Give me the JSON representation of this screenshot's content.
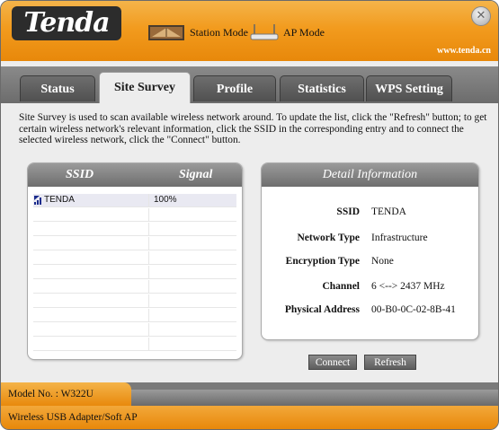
{
  "header": {
    "logo": "Tenda",
    "station_mode": "Station Mode",
    "ap_mode": "AP Mode",
    "website": "www.tenda.cn",
    "close_icon": "close-icon"
  },
  "tabs": [
    {
      "label": "Status",
      "active": false
    },
    {
      "label": "Site Survey",
      "active": true
    },
    {
      "label": "Profile",
      "active": false
    },
    {
      "label": "Statistics",
      "active": false
    },
    {
      "label": "WPS Setting",
      "active": false
    }
  ],
  "description": "Site Survey is used to scan available wireless network around. To update the list, click the \"Refresh\" button; to get certain wireless network's relevant information, click the SSID in the corresponding entry and to connect the selected wireless network, click the \"Connect\" button.",
  "ssid_list": {
    "headers": {
      "ssid": "SSID",
      "signal": "Signal"
    },
    "rows": [
      {
        "ssid": "TENDA",
        "signal": "100%",
        "icon": "signal-icon"
      }
    ]
  },
  "detail": {
    "title": "Detail Information",
    "fields": [
      {
        "label": "SSID",
        "value": "TENDA"
      },
      {
        "label": "Network Type",
        "value": "Infrastructure"
      },
      {
        "label": "Encryption Type",
        "value": "None"
      },
      {
        "label": "Channel",
        "value": "6 <--> 2437 MHz"
      },
      {
        "label": "Physical Address",
        "value": "00-B0-0C-02-8B-41"
      }
    ]
  },
  "buttons": {
    "connect": "Connect",
    "refresh": "Refresh"
  },
  "footer": {
    "model": "Model No. : W322U",
    "product": "Wireless USB Adapter/Soft AP"
  },
  "colors": {
    "accent": "#f29b1e",
    "dark": "#5e5e5e"
  }
}
